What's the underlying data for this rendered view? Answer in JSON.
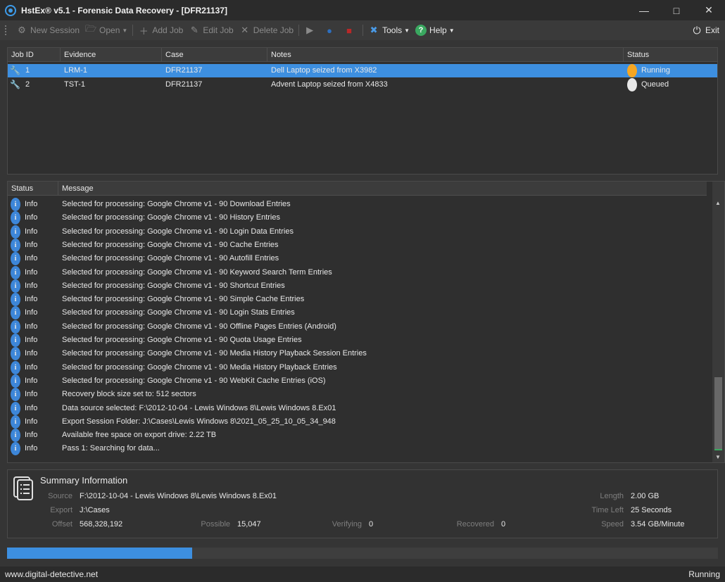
{
  "window": {
    "title": "HstEx® v5.1 - Forensic Data Recovery - [DFR21137]",
    "minimize_icon": "minimize-icon",
    "maximize_icon": "maximize-icon",
    "close_icon": "close-icon"
  },
  "toolbar": {
    "new_session": "New Session",
    "open": "Open",
    "add_job": "Add Job",
    "edit_job": "Edit Job",
    "delete_job": "Delete Job",
    "tools": "Tools",
    "help": "Help",
    "exit": "Exit"
  },
  "jobs": {
    "columns": [
      "Job ID",
      "Evidence",
      "Case",
      "Notes",
      "Status"
    ],
    "rows": [
      {
        "id": "1",
        "evidence": "LRM-1",
        "case": "DFR21137",
        "notes": "Dell Laptop seized from X3982",
        "status": "Running",
        "status_color": "#f5a623",
        "selected": true
      },
      {
        "id": "2",
        "evidence": "TST-1",
        "case": "DFR21137",
        "notes": "Advent Laptop seized from X4833",
        "status": "Queued",
        "status_color": "#e8e8e8",
        "selected": false
      }
    ]
  },
  "log": {
    "columns": [
      "Status",
      "Message"
    ],
    "rows": [
      {
        "status": "Info",
        "message": "Selected for processing: Google Chrome v1 - 90 Download Entries"
      },
      {
        "status": "Info",
        "message": "Selected for processing: Google Chrome v1 - 90 History Entries"
      },
      {
        "status": "Info",
        "message": "Selected for processing: Google Chrome v1 - 90 Login Data Entries"
      },
      {
        "status": "Info",
        "message": "Selected for processing: Google Chrome v1 - 90 Cache Entries"
      },
      {
        "status": "Info",
        "message": "Selected for processing: Google Chrome v1 - 90 Autofill Entries"
      },
      {
        "status": "Info",
        "message": "Selected for processing: Google Chrome v1 - 90 Keyword Search Term Entries"
      },
      {
        "status": "Info",
        "message": "Selected for processing: Google Chrome v1 - 90 Shortcut Entries"
      },
      {
        "status": "Info",
        "message": "Selected for processing: Google Chrome v1 - 90 Simple Cache Entries"
      },
      {
        "status": "Info",
        "message": "Selected for processing: Google Chrome v1 - 90 Login Stats Entries"
      },
      {
        "status": "Info",
        "message": "Selected for processing: Google Chrome v1 - 90 Offline Pages Entries (Android)"
      },
      {
        "status": "Info",
        "message": "Selected for processing: Google Chrome v1 - 90 Quota Usage Entries"
      },
      {
        "status": "Info",
        "message": "Selected for processing: Google Chrome v1 - 90 Media History Playback Session Entries"
      },
      {
        "status": "Info",
        "message": "Selected for processing: Google Chrome v1 - 90 Media History Playback Entries"
      },
      {
        "status": "Info",
        "message": "Selected for processing: Google Chrome v1 - 90 WebKit Cache Entries (iOS)"
      },
      {
        "status": "Info",
        "message": "Recovery block size set to: 512 sectors"
      },
      {
        "status": "Info",
        "message": "Data source selected: F:\\2012-10-04 - Lewis Windows 8\\Lewis Windows 8.Ex01"
      },
      {
        "status": "Info",
        "message": "Export Session Folder: J:\\Cases\\Lewis Windows 8\\2021_05_25_10_05_34_948"
      },
      {
        "status": "Info",
        "message": "Available free space on export drive: 2.22 TB"
      },
      {
        "status": "Info",
        "message": "Pass 1: Searching for data..."
      }
    ]
  },
  "summary": {
    "title": "Summary Information",
    "source_label": "Source",
    "source": "F:\\2012-10-04 - Lewis Windows 8\\Lewis Windows 8.Ex01",
    "export_label": "Export",
    "export": "J:\\Cases",
    "offset_label": "Offset",
    "offset": "568,328,192",
    "possible_label": "Possible",
    "possible": "15,047",
    "verifying_label": "Verifying",
    "verifying": "0",
    "recovered_label": "Recovered",
    "recovered": "0",
    "length_label": "Length",
    "length": "2.00 GB",
    "time_left_label": "Time Left",
    "time_left": "25 Seconds",
    "speed_label": "Speed",
    "speed": "3.54 GB/Minute"
  },
  "progress": {
    "fraction": 0.26,
    "color": "#3d8fe0"
  },
  "statusbar": {
    "website": "www.digital-detective.net",
    "state": "Running"
  }
}
